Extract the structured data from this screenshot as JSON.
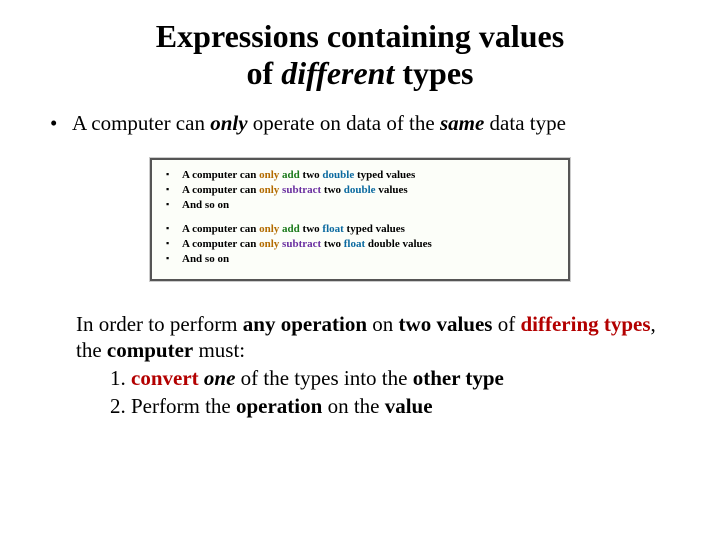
{
  "title": {
    "line1a": "Expressions containing values",
    "line2a": "of ",
    "line2b_italic": "different",
    "line2c": " types"
  },
  "bullet1": {
    "dot": "•",
    "t1": "A computer can ",
    "only": "only",
    "t2": " operate on data of the ",
    "same": "same",
    "t3": " data type"
  },
  "inset": {
    "g1": {
      "l1": {
        "a": "A computer can ",
        "only": "only ",
        "add": "add",
        "b": " two ",
        "type": "double",
        "c": " typed values"
      },
      "l2": {
        "a": "A computer can ",
        "only": "only ",
        "sub": "subtract",
        "b": " two ",
        "type": "double",
        "c": " values"
      },
      "l3": {
        "a": "And so on"
      }
    },
    "g2": {
      "l1": {
        "a": "A computer can ",
        "only": "only ",
        "add": "add",
        "b": " two ",
        "type": "float",
        "c": " typed values"
      },
      "l2": {
        "a": "A computer can ",
        "only": "only ",
        "sub": "subtract",
        "b": " two ",
        "type": "float",
        "c": " double values"
      },
      "l3": {
        "a": "And so on"
      }
    }
  },
  "para": {
    "a": "In order to perform ",
    "b": "any operation",
    "c": " on ",
    "d": "two values",
    "e": " of ",
    "f": "differing types",
    "g": ", the ",
    "h": "computer",
    "i": " must:"
  },
  "steps": {
    "s1": {
      "n": "1. ",
      "a": "convert ",
      "b": "one",
      "c": " of the types into the ",
      "d": "other type"
    },
    "s2": {
      "n": "2. ",
      "a": "Perform the ",
      "b": "operation",
      "c": " on the ",
      "d": "value"
    }
  }
}
